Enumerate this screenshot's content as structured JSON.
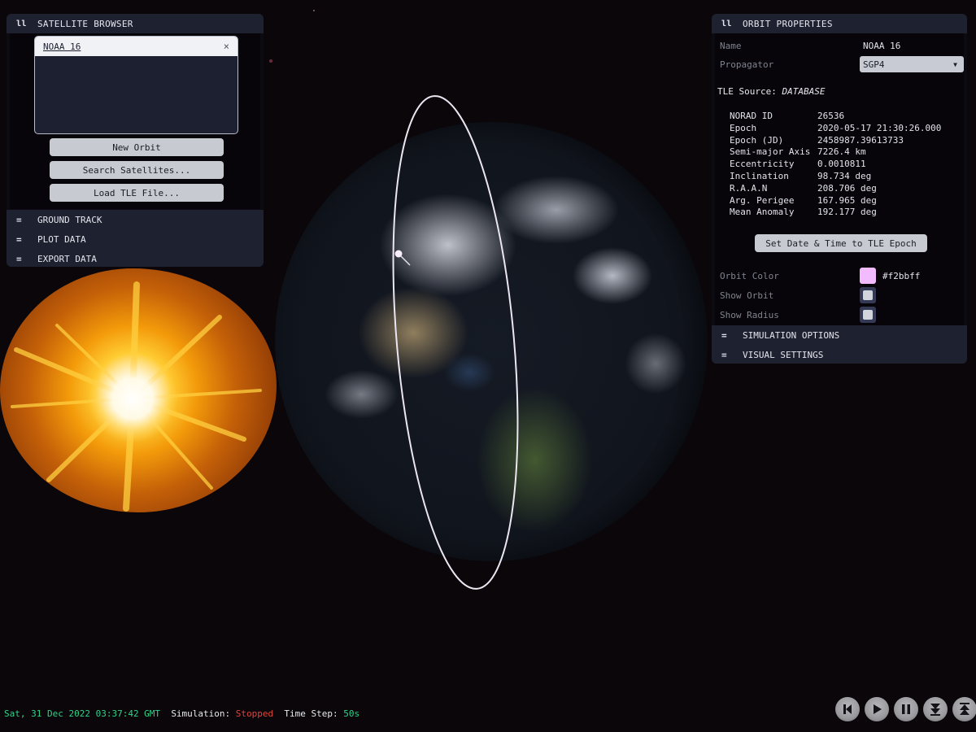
{
  "satellite_browser": {
    "title": "SATELLITE BROWSER",
    "selected_satellite": "NOAA 16",
    "remove_label": "×",
    "buttons": {
      "new_orbit": "New Orbit",
      "search_satellites": "Search Satellites...",
      "load_tle": "Load TLE File..."
    },
    "sections": [
      "GROUND TRACK",
      "PLOT DATA",
      "EXPORT DATA"
    ]
  },
  "orbit_properties": {
    "title": "ORBIT PROPERTIES",
    "name_label": "Name",
    "name_value": "NOAA 16",
    "propagator_label": "Propagator",
    "propagator_value": "SGP4",
    "tle_source_label": "TLE Source:",
    "tle_source_value": "DATABASE",
    "tle": [
      {
        "key": "NORAD ID",
        "value": "26536"
      },
      {
        "key": "Epoch",
        "value": "2020-05-17 21:30:26.000"
      },
      {
        "key": "Epoch (JD)",
        "value": "2458987.39613733"
      },
      {
        "key": "Semi-major Axis",
        "value": "7226.4 km"
      },
      {
        "key": "Eccentricity",
        "value": "0.0010811"
      },
      {
        "key": "Inclination",
        "value": "98.734 deg"
      },
      {
        "key": "R.A.A.N",
        "value": "208.706 deg"
      },
      {
        "key": "Arg. Perigee",
        "value": "167.965 deg"
      },
      {
        "key": "Mean Anomaly",
        "value": "192.177 deg"
      }
    ],
    "set_epoch_button": "Set Date & Time to TLE Epoch",
    "orbit_color_label": "Orbit Color",
    "orbit_color_value": "#f2bbff",
    "show_orbit_label": "Show Orbit",
    "show_orbit_checked": false,
    "show_radius_label": "Show Radius",
    "show_radius_checked": false,
    "sections": [
      "SIMULATION OPTIONS",
      "VISUAL SETTINGS"
    ]
  },
  "status_bar": {
    "datetime": "Sat, 31 Dec 2022 03:37:42 GMT",
    "simulation_label": "Simulation:",
    "simulation_state": "Stopped",
    "time_step_label": "Time Step:",
    "time_step_value": "50s"
  },
  "playback_controls": [
    {
      "name": "skip-to-start",
      "icon": "skip-back-icon"
    },
    {
      "name": "play",
      "icon": "play-icon"
    },
    {
      "name": "pause",
      "icon": "pause-icon"
    },
    {
      "name": "slow-down",
      "icon": "decrease-speed-icon"
    },
    {
      "name": "speed-up",
      "icon": "increase-speed-icon"
    }
  ],
  "colors": {
    "panel_header": "#1e2230",
    "status_green": "#2fd38a",
    "status_red": "#e0453c",
    "orbit_color": "#f2bbff"
  }
}
